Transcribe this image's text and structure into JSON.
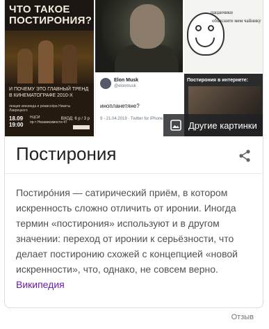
{
  "images": {
    "poster": {
      "title": "ЧТО ТАКОЕ ПОСТИРОНИЯ?",
      "subtitle": "И ПОЧЕМУ ЭТО ГЛАВНЫЙ ТРЕНД В КИНЕМАТОГРАФЕ 2010-Х",
      "lecture": "лекция киноведа и режиссёра Никиты Лаврецкого",
      "date": "18.09\n19:00",
      "venue": "НЦСИ\nпр-т Независимости 47",
      "entry": "ВХОД: 6 р / 3 р"
    },
    "meme": {
      "line1": "пацанчики",
      "line2": "объясните мем чайнику"
    },
    "tweet": {
      "name": "Elon Musk",
      "handle": "@elonmusk",
      "text": "инопланетяне?",
      "meta": "9 - 21.04.2019 · Twitter for iPhone"
    },
    "meme2_title": "Постирония в интернете:",
    "more_label": "Другие картинки"
  },
  "entity": {
    "title": "Постирония",
    "description": "Постиро́ния — сатирический приём, в котором искренность сложно отличить от иронии. Иногда термин «постирония» используют и в другом значении: переход от иронии к серьёзности, что делает постиронию схожей с концепцией «новой искренности», что, однако, не совсем верно.",
    "source": "Википедия"
  },
  "feedback": "Отзыв",
  "colors": {
    "link": "#681da8",
    "text": "#4d5156",
    "title": "#202124"
  },
  "icons": {
    "share": "share-icon",
    "image": "image-icon"
  }
}
